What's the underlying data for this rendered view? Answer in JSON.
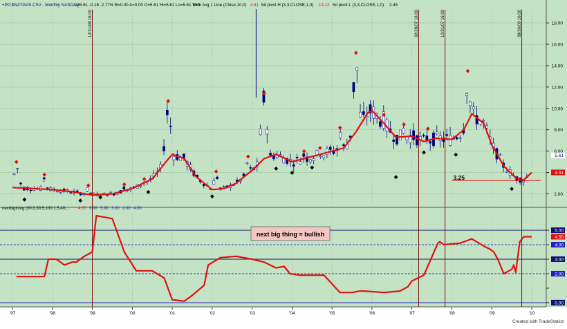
{
  "header": {
    "symbol": "+PD:$NATGAS.CSV - Monthly  NASDAQ",
    "ohlc": "L=5.61  -0.16  -2.77%  B=0.00  A=0.00  O=5.61  Hi=5.61  Lo=5.61  V=0",
    "study1": "Mov Avg 1 Line (Close,10,0)",
    "study1_value": "4.81",
    "study2": "5d pivot H (3,3,CLOSE,1,0)",
    "study2_value": "13.12",
    "study3": "5d pivot L (3,3,CLOSE,1,0)",
    "study3_value": "2.45"
  },
  "indicator_header": {
    "name": "nextbigthing (30,0,30,5,100,1.5,40,...",
    "values": [
      "4.55",
      "3.00",
      "5.00",
      "3.00",
      "2.00",
      "4.00"
    ]
  },
  "annotation_box": "next big thing = bullish",
  "support_label": "3.25",
  "footer": "Created with TradeStation",
  "colors": {
    "background": "#c4e3c4",
    "price_up": "#ffffff",
    "price_down": "#00007f",
    "moving_average": "#e01010",
    "pivot_high": "#e01010",
    "pivot_low": "#000000",
    "event_line": "#7a1010",
    "indicator": "#e01010",
    "level_blue": "#2020c0",
    "level_navy": "#101070"
  },
  "chart_data": [
    {
      "type": "line",
      "title": "+PD:$NATGAS.CSV - Monthly NASDAQ",
      "x_ticks": [
        "'97",
        "'98",
        "'99",
        "'00",
        "'01",
        "'02",
        "'03",
        "'04",
        "'05",
        "'06",
        "'07",
        "'08",
        "'09",
        "'10"
      ],
      "y_ticks": [
        "2.00",
        "4.00",
        "6.00",
        "8.00",
        "10.00",
        "12.00",
        "14.00",
        "16.00",
        "18.00"
      ],
      "ylim": [
        1.0,
        19.3
      ],
      "last_price_label": "5.61",
      "ma_label": "4.01",
      "support_level": 3.25,
      "series": [
        {
          "name": "Mov Avg 1 Line (Close,10,0)",
          "x": [
            1997.0,
            1997.5,
            1998.0,
            1998.5,
            1999.0,
            1999.5,
            2000.0,
            2000.5,
            2000.8,
            2001.0,
            2001.3,
            2001.6,
            2002.0,
            2002.3,
            2002.6,
            2003.0,
            2003.3,
            2003.6,
            2004.0,
            2004.3,
            2004.6,
            2005.0,
            2005.3,
            2005.6,
            2005.9,
            2006.0,
            2006.3,
            2006.6,
            2007.0,
            2007.3,
            2007.6,
            2008.0,
            2008.3,
            2008.5,
            2008.8,
            2009.0,
            2009.3,
            2009.6,
            2009.8,
            2010.0
          ],
          "values": [
            2.6,
            2.5,
            2.4,
            2.2,
            1.9,
            2.0,
            2.5,
            3.4,
            4.8,
            5.7,
            5.3,
            3.6,
            2.4,
            2.5,
            3.0,
            4.2,
            5.3,
            5.7,
            5.0,
            5.3,
            5.6,
            6.0,
            6.3,
            7.8,
            9.6,
            9.8,
            8.6,
            7.3,
            7.4,
            6.9,
            7.2,
            7.1,
            8.0,
            9.5,
            8.6,
            6.6,
            4.6,
            3.5,
            3.3,
            4.0
          ]
        },
        {
          "name": "5d pivot H",
          "x": [
            1997.1,
            1997.8,
            1998.9,
            1999.8,
            2000.3,
            2000.9,
            2002.1,
            2002.9,
            2003.3,
            2004.3,
            2004.7,
            2005.2,
            2005.6,
            2006.3,
            2006.8,
            2007.4,
            2008.4
          ],
          "values": [
            4.8,
            3.6,
            2.6,
            2.7,
            3.2,
            10.5,
            3.9,
            5.3,
            11.2,
            5.8,
            6.1,
            8.0,
            15.0,
            9.2,
            8.3,
            7.9,
            13.3
          ]
        },
        {
          "name": "5d pivot L",
          "x": [
            1997.3,
            1998.7,
            1999.2,
            2000.4,
            2002.0,
            2003.6,
            2004.0,
            2004.5,
            2006.6,
            2007.3,
            2008.1,
            2009.5
          ],
          "values": [
            1.6,
            1.5,
            1.8,
            2.3,
            1.9,
            4.5,
            4.1,
            4.6,
            3.7,
            6.0,
            5.8,
            2.6
          ]
        }
      ]
    },
    {
      "type": "line",
      "title": "nextbigthing (30,0,30,5,100,1.5,40,...",
      "x_ticks": [
        "'97",
        "'98",
        "'99",
        "'00",
        "'01",
        "'02",
        "'03",
        "'04",
        "'05",
        "'06",
        "'07",
        "'08",
        "'09",
        "'10"
      ],
      "y_ticks": [
        "0.00",
        "1.00",
        "2.00",
        "3.00",
        "4.00",
        "5.00"
      ],
      "ylim": [
        -0.1,
        6.1
      ],
      "right_labels": [
        "5.00",
        "4.55",
        "4.00",
        "3.00",
        "2.00",
        "0.00"
      ],
      "levels": [
        5.0,
        4.0,
        3.0,
        2.0,
        0.0
      ],
      "series": [
        {
          "name": "nextbigthing",
          "x": [
            1997.1,
            1997.8,
            1997.9,
            1998.1,
            1998.3,
            1998.5,
            1998.6,
            1998.8,
            1999.0,
            1999.1,
            1999.5,
            1999.8,
            2000.1,
            2000.5,
            2000.8,
            2001.0,
            2001.3,
            2001.5,
            2001.8,
            2001.9,
            2002.2,
            2002.6,
            2003.0,
            2003.3,
            2003.6,
            2003.8,
            2003.95,
            2004.2,
            2004.5,
            2004.8,
            2005.2,
            2005.5,
            2005.7,
            2005.8,
            2006.3,
            2006.7,
            2006.9,
            2007.0,
            2007.3,
            2007.65,
            2007.7,
            2007.8,
            2008.2,
            2008.5,
            2008.8,
            2008.95,
            2009.05,
            2009.15,
            2009.3,
            2009.5,
            2009.55,
            2009.6,
            2009.7,
            2009.8,
            2010.0
          ],
          "values": [
            1.8,
            1.8,
            3.0,
            3.0,
            2.6,
            2.8,
            2.8,
            3.2,
            3.5,
            6.0,
            5.8,
            3.5,
            2.2,
            2.2,
            1.7,
            0.2,
            0.1,
            0.5,
            1.2,
            2.6,
            3.1,
            3.2,
            3.0,
            2.8,
            2.4,
            2.5,
            2.0,
            1.9,
            1.9,
            1.9,
            0.7,
            0.7,
            0.8,
            0.8,
            0.7,
            0.8,
            1.1,
            1.5,
            1.9,
            4.1,
            4.2,
            4.0,
            4.1,
            4.4,
            3.9,
            3.7,
            3.5,
            3.0,
            2.0,
            2.3,
            2.6,
            2.1,
            4.2,
            4.55,
            4.55
          ]
        }
      ]
    }
  ],
  "events": [
    {
      "label": "12/31/98 16:00",
      "x": 1999.0
    },
    {
      "label": "02/28/07 16:00",
      "x": 2007.17
    },
    {
      "label": "10/31/07 16:00",
      "x": 2007.83
    },
    {
      "label": "09/30/09 16:00",
      "x": 2009.75
    }
  ]
}
